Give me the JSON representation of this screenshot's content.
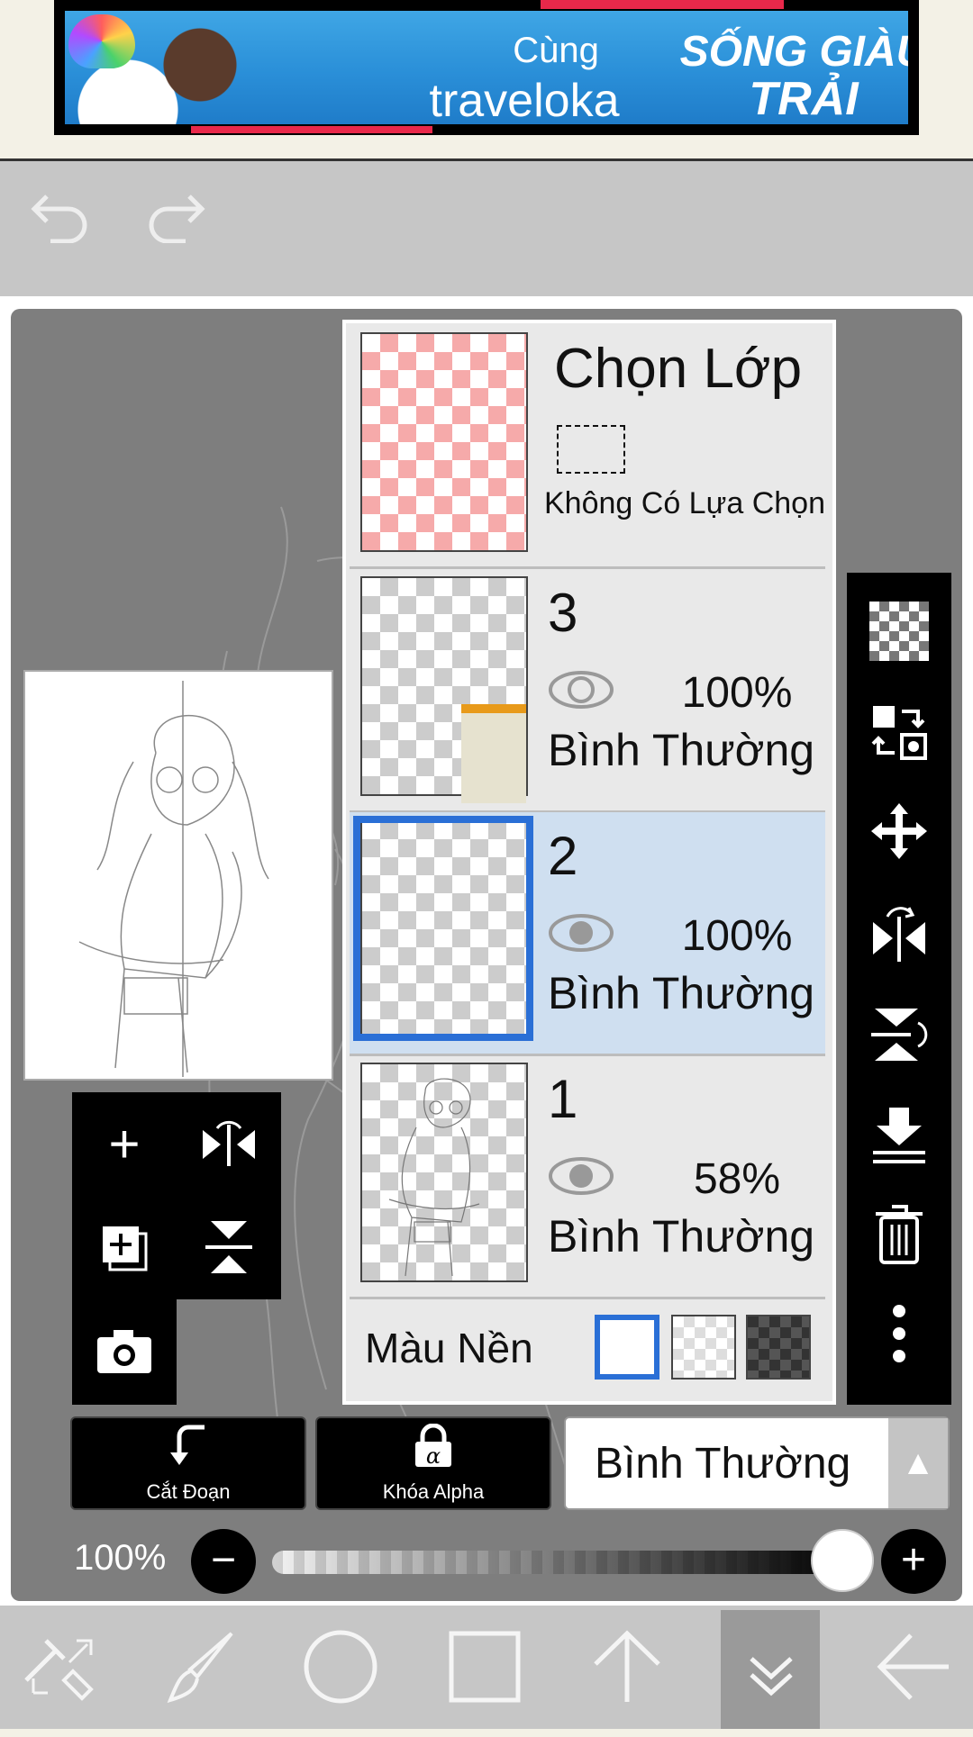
{
  "ad": {
    "line1": "Cùng",
    "brand": "traveloka",
    "slogan_line1": "SỐNG GIÀU",
    "slogan_line2": "TRẢI NGHIỆM"
  },
  "toolbar": {
    "undo": "undo-icon",
    "redo": "redo-icon"
  },
  "layers_panel": {
    "selection": {
      "title": "Chọn Lớp",
      "subtitle": "Không Có Lựa Chọn"
    },
    "layers": [
      {
        "name": "3",
        "opacity": "100%",
        "blend": "Bình Thường",
        "visible": true,
        "selected": false
      },
      {
        "name": "2",
        "opacity": "100%",
        "blend": "Bình Thường",
        "visible": true,
        "selected": true
      },
      {
        "name": "1",
        "opacity": "58%",
        "blend": "Bình Thường",
        "visible": true,
        "selected": false
      }
    ],
    "background": {
      "label": "Màu Nền",
      "options": [
        "white",
        "transparent",
        "dark"
      ],
      "selected": "white"
    }
  },
  "controls": {
    "clip_label": "Cắt Đoạn",
    "alpha_lock_label": "Khóa Alpha",
    "blend_mode": "Bình Thường",
    "opacity_label": "100%",
    "opacity_value": 1.0
  },
  "colors": {
    "accent": "#2a6fd6",
    "selected_row": "#cfdff0",
    "ad_red": "#e8284a"
  }
}
